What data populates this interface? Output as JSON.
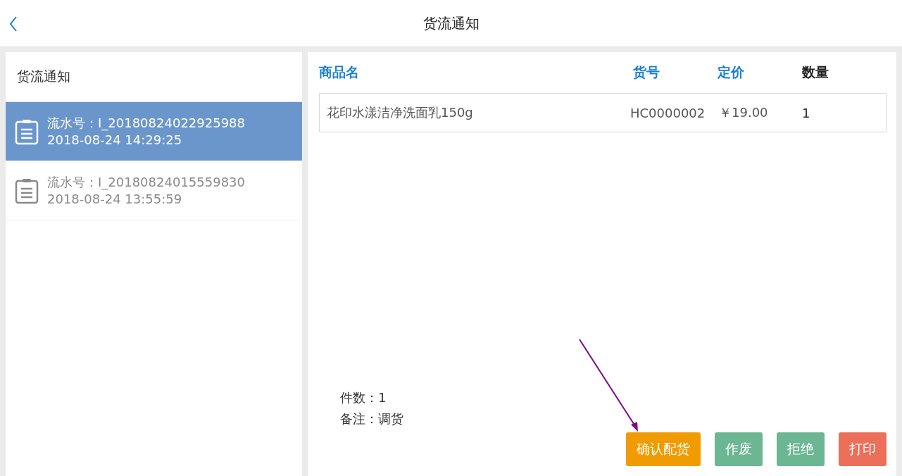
{
  "header": {
    "title": "货流通知"
  },
  "sidebar": {
    "title": "货流通知",
    "items": [
      {
        "serial": "流水号：I_20180824022925988",
        "time": "2018-08-24 14:29:25",
        "selected": true
      },
      {
        "serial": "流水号：I_20180824015559830",
        "time": "2018-08-24 13:55:59",
        "selected": false
      }
    ]
  },
  "table": {
    "columns": [
      "商品名",
      "货号",
      "定价",
      "数量"
    ],
    "rows": [
      {
        "cells": [
          "花印水漾洁净洗面乳150g",
          "HC0000002",
          "￥19.00",
          "1"
        ]
      }
    ]
  },
  "summary": {
    "count": "件数：1",
    "remark": "备注：调货"
  },
  "buttons": [
    {
      "label": "确认配货",
      "color": "#f09c00"
    },
    {
      "label": "作废",
      "color": "#6bb693"
    },
    {
      "label": "拒绝",
      "color": "#6bb693"
    },
    {
      "label": "打印",
      "color": "#ec6f5a"
    }
  ]
}
